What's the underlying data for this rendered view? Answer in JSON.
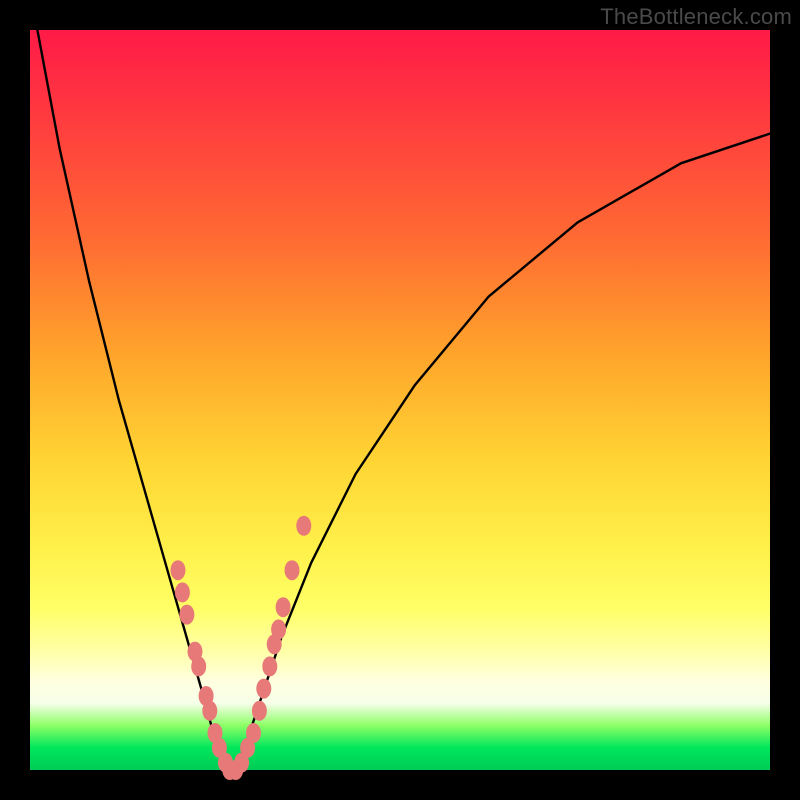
{
  "watermark": "TheBottleneck.com",
  "colors": {
    "frame": "#000000",
    "curve_stroke": "#000000",
    "marker_fill": "#e77a78",
    "marker_stroke": "#d65f5d"
  },
  "chart_data": {
    "type": "line",
    "title": "",
    "xlabel": "",
    "ylabel": "",
    "xlim": [
      0,
      100
    ],
    "ylim": [
      0,
      100
    ],
    "note": "Bottleneck-style V curve. x ≈ component balance (%), y ≈ bottleneck (%). Minimum ≈ 0% near x ≈ 27. Values estimated from pixel geometry (no axis ticks present).",
    "series": [
      {
        "name": "bottleneck-curve",
        "x": [
          1,
          4,
          8,
          12,
          16,
          20,
          22,
          24,
          25,
          26,
          27,
          28,
          29,
          30,
          32,
          34,
          38,
          44,
          52,
          62,
          74,
          88,
          100
        ],
        "y": [
          100,
          84,
          66,
          50,
          36,
          22,
          15,
          8,
          4,
          1,
          0,
          1,
          3,
          6,
          12,
          18,
          28,
          40,
          52,
          64,
          74,
          82,
          86
        ]
      }
    ],
    "markers": {
      "name": "highlighted-points",
      "note": "Salmon lozenge markers clustered on lower flanks of the V",
      "points": [
        {
          "x": 20.0,
          "y": 27
        },
        {
          "x": 20.6,
          "y": 24
        },
        {
          "x": 21.2,
          "y": 21
        },
        {
          "x": 22.3,
          "y": 16
        },
        {
          "x": 22.8,
          "y": 14
        },
        {
          "x": 23.8,
          "y": 10
        },
        {
          "x": 24.3,
          "y": 8
        },
        {
          "x": 25.0,
          "y": 5
        },
        {
          "x": 25.6,
          "y": 3
        },
        {
          "x": 26.4,
          "y": 1
        },
        {
          "x": 27.0,
          "y": 0
        },
        {
          "x": 27.8,
          "y": 0
        },
        {
          "x": 28.6,
          "y": 1
        },
        {
          "x": 29.4,
          "y": 3
        },
        {
          "x": 30.2,
          "y": 5
        },
        {
          "x": 31.0,
          "y": 8
        },
        {
          "x": 31.6,
          "y": 11
        },
        {
          "x": 32.4,
          "y": 14
        },
        {
          "x": 33.0,
          "y": 17
        },
        {
          "x": 33.6,
          "y": 19
        },
        {
          "x": 34.2,
          "y": 22
        },
        {
          "x": 35.4,
          "y": 27
        },
        {
          "x": 37.0,
          "y": 33
        }
      ]
    }
  }
}
